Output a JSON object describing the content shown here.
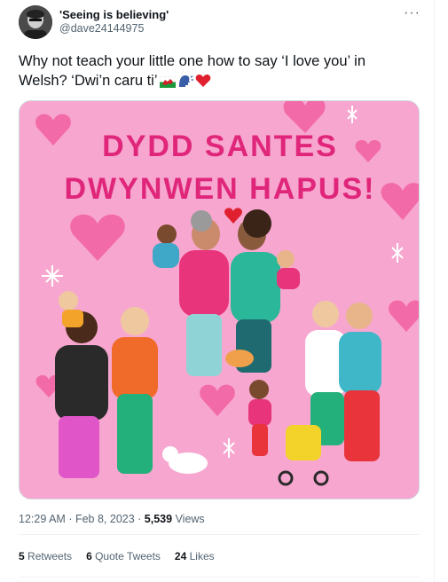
{
  "user": {
    "name": "'Seeing is believing'",
    "handle": "@dave24144975"
  },
  "more_label": "···",
  "tweet": {
    "text": "Why not teach your little one how to say ‘I love you’ in Welsh? ‘Dwi’n caru ti’"
  },
  "media": {
    "line1": "DYDD SANTES",
    "line2": "DWYNWEN HAPUS!"
  },
  "meta": {
    "time": "12:29 AM",
    "date": "Feb 8, 2023",
    "views_count": "5,539",
    "views_label": "Views"
  },
  "stats": {
    "retweets_count": "5",
    "retweets_label": "Retweets",
    "quotes_count": "6",
    "quotes_label": "Quote Tweets",
    "likes_count": "24",
    "likes_label": "Likes"
  },
  "colors": {
    "poster_bg": "#f7a6cf",
    "poster_title": "#e0267a",
    "heart": "#f26aa8",
    "text_secondary": "#536471"
  },
  "icons": [
    "welsh-flag-icon",
    "speaking-head-icon",
    "red-heart-icon"
  ]
}
